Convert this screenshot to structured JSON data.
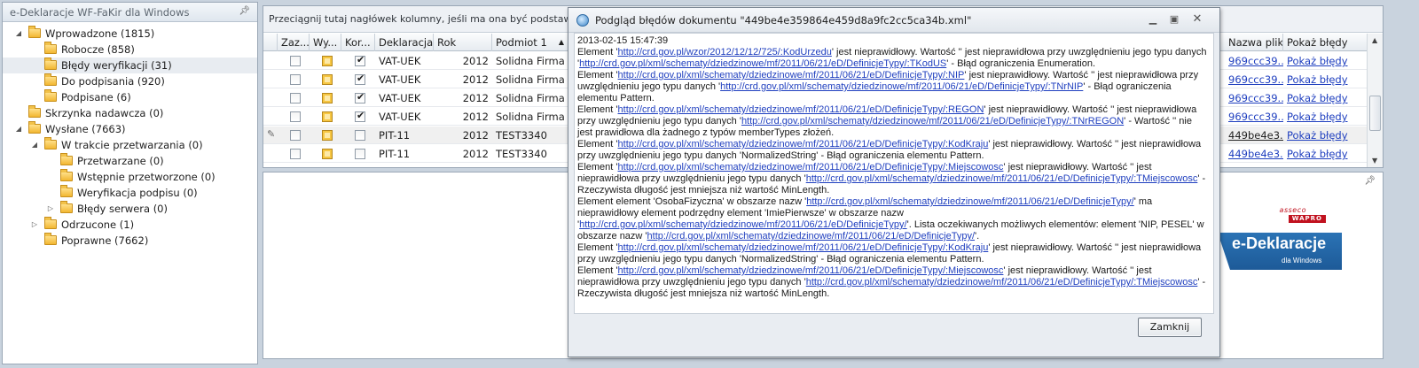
{
  "tree": {
    "title": "e-Deklaracje WF-FaKir dla Windows",
    "items": [
      {
        "label": "Wprowadzone (1815)",
        "expanded": true
      },
      {
        "label": "Robocze (858)"
      },
      {
        "label": "Błędy weryfikacji (31)",
        "selected": true
      },
      {
        "label": "Do podpisania (920)"
      },
      {
        "label": "Podpisane (6)"
      },
      {
        "label": "Skrzynka nadawcza (0)"
      },
      {
        "label": "Wysłane (7663)",
        "expanded": true
      },
      {
        "label": "W trakcie przetwarzania (0)",
        "expanded": true
      },
      {
        "label": "Przetwarzane (0)"
      },
      {
        "label": "Wstępnie przetworzone (0)"
      },
      {
        "label": "Weryfikacja podpisu (0)"
      },
      {
        "label": "Błędy serwera (0)",
        "expanded": false
      },
      {
        "label": "Odrzucone (1)",
        "expanded": false
      },
      {
        "label": "Poprawne (7662)"
      }
    ]
  },
  "grid": {
    "group_hint": "Przeciągnij tutaj nagłówek kolumny, jeśli ma ona być podstawą grupowania",
    "columns": {
      "zaz": "Zaz...",
      "wy": "Wy...",
      "kor": "Kor...",
      "deklaracja": "Deklaracja",
      "rok": "Rok",
      "podmiot": "Podmiot 1",
      "nazwa_pliku": "Nazwa pliku",
      "pokaz_bledy": "Pokaż błędy"
    },
    "rows": [
      {
        "zaz": false,
        "kor": true,
        "deklaracja": "VAT-UEK",
        "rok": "2012",
        "podmiot": "Solidna Firma ...",
        "plik": "969ccc39...",
        "pokaz": "Pokaż błędy"
      },
      {
        "zaz": false,
        "kor": true,
        "deklaracja": "VAT-UEK",
        "rok": "2012",
        "podmiot": "Solidna Firma ...",
        "plik": "969ccc39...",
        "pokaz": "Pokaż błędy"
      },
      {
        "zaz": false,
        "kor": true,
        "deklaracja": "VAT-UEK",
        "rok": "2012",
        "podmiot": "Solidna Firma ...",
        "plik": "969ccc39...",
        "pokaz": "Pokaż błędy"
      },
      {
        "zaz": false,
        "kor": true,
        "deklaracja": "VAT-UEK",
        "rok": "2012",
        "podmiot": "Solidna Firma ...",
        "plik": "969ccc39...",
        "pokaz": "Pokaż błędy"
      },
      {
        "zaz": false,
        "kor": false,
        "deklaracja": "PIT-11",
        "rok": "2012",
        "podmiot": "TEST3340",
        "plik": "449be4e3...",
        "pokaz": "Pokaż błędy"
      },
      {
        "zaz": false,
        "kor": false,
        "deklaracja": "PIT-11",
        "rok": "2012",
        "podmiot": "TEST3340",
        "plik": "449be4e3...",
        "pokaz": "Pokaż błędy"
      }
    ]
  },
  "logo": {
    "asseco": "asseco",
    "wapro": "WAPRO",
    "product": "e-Deklaracje",
    "product_sub": "dla Windows"
  },
  "dialog": {
    "title": "Podgląd błędów dokumentu \"449be4e359864e459d8a9fc2cc5ca34b.xml\"",
    "close_label": "Zamknij",
    "errors": {
      "timestamp": "2013-02-15 15:47:39",
      "e1": {
        "pre": "Element '",
        "url1": "http://crd.gov.pl/wzor/2012/12/12/725/:KodUrzedu",
        "mid": "' jest nieprawidłowy. Wartość '' jest nieprawidłowa przy uwzględnieniu jego typu danych '",
        "url2": "http://crd.gov.pl/xml/schematy/dziedzinowe/mf/2011/06/21/eD/DefinicjeTypy/:TKodUS",
        "post": "' - Błąd ograniczenia Enumeration."
      },
      "e2": {
        "pre": "Element '",
        "url1": "http://crd.gov.pl/xml/schematy/dziedzinowe/mf/2011/06/21/eD/DefinicjeTypy/:NIP",
        "mid": "' jest nieprawidłowy. Wartość '' jest nieprawidłowa przy uwzględnieniu jego typu danych '",
        "url2": "http://crd.gov.pl/xml/schematy/dziedzinowe/mf/2011/06/21/eD/DefinicjeTypy/:TNrNIP",
        "post": "' - Błąd ograniczenia elementu Pattern."
      },
      "e3": {
        "pre": "Element '",
        "url1": "http://crd.gov.pl/xml/schematy/dziedzinowe/mf/2011/06/21/eD/DefinicjeTypy/:REGON",
        "mid": "' jest nieprawidłowy. Wartość '' jest nieprawidłowa przy uwzględnieniu jego typu danych '",
        "url2": "http://crd.gov.pl/xml/schematy/dziedzinowe/mf/2011/06/21/eD/DefinicjeTypy/:TNrREGON",
        "post": "' - Wartość '' nie jest prawidłowa dla żadnego z typów memberTypes złożeń."
      },
      "e4": {
        "pre": "Element '",
        "url1": "http://crd.gov.pl/xml/schematy/dziedzinowe/mf/2011/06/21/eD/DefinicjeTypy/:KodKraju",
        "post": "' jest nieprawidłowy. Wartość '' jest nieprawidłowa przy uwzględnieniu jego typu danych 'NormalizedString' - Błąd ograniczenia elementu Pattern."
      },
      "e5": {
        "pre": "Element '",
        "url1": "http://crd.gov.pl/xml/schematy/dziedzinowe/mf/2011/06/21/eD/DefinicjeTypy/:Miejscowosc",
        "mid": "' jest nieprawidłowy. Wartość '' jest nieprawidłowa przy uwzględnieniu jego typu danych '",
        "url2": "http://crd.gov.pl/xml/schematy/dziedzinowe/mf/2011/06/21/eD/DefinicjeTypy/:TMiejscowosc",
        "post": "' - Rzeczywista długość jest mniejsza niż wartość MinLength."
      },
      "e6": {
        "pre": "Element element 'OsobaFizyczna' w obszarze nazw '",
        "url1": "http://crd.gov.pl/xml/schematy/dziedzinowe/mf/2011/06/21/eD/DefinicjeTypy/",
        "mid": "' ma nieprawidłowy element podrzędny element 'ImiePierwsze' w obszarze nazw '",
        "url2": "http://crd.gov.pl/xml/schematy/dziedzinowe/mf/2011/06/21/eD/DefinicjeTypy/",
        "mid2": "'. Lista oczekiwanych możliwych elementów: element 'NIP, PESEL' w obszarze nazw '",
        "url3": "http://crd.gov.pl/xml/schematy/dziedzinowe/mf/2011/06/21/eD/DefinicjeTypy/",
        "post": "'."
      },
      "e7": {
        "pre": "Element '",
        "url1": "http://crd.gov.pl/xml/schematy/dziedzinowe/mf/2011/06/21/eD/DefinicjeTypy/:KodKraju",
        "post": "' jest nieprawidłowy. Wartość '' jest nieprawidłowa przy uwzględnieniu jego typu danych 'NormalizedString' - Błąd ograniczenia elementu Pattern."
      },
      "e8": {
        "pre": "Element '",
        "url1": "http://crd.gov.pl/xml/schematy/dziedzinowe/mf/2011/06/21/eD/DefinicjeTypy/:Miejscowosc",
        "mid": "' jest nieprawidłowy. Wartość '' jest nieprawidłowa przy uwzględnieniu jego typu danych '",
        "url2": "http://crd.gov.pl/xml/schematy/dziedzinowe/mf/2011/06/21/eD/DefinicjeTypy/:TMiejscowosc",
        "post": "' - Rzeczywista długość jest mniejsza niż wartość MinLength."
      }
    }
  },
  "colors": {
    "link": "#1f3fbf",
    "folder": "#f2b731",
    "logo_blue": "#1d5a98",
    "logo_red": "#c1121f"
  }
}
